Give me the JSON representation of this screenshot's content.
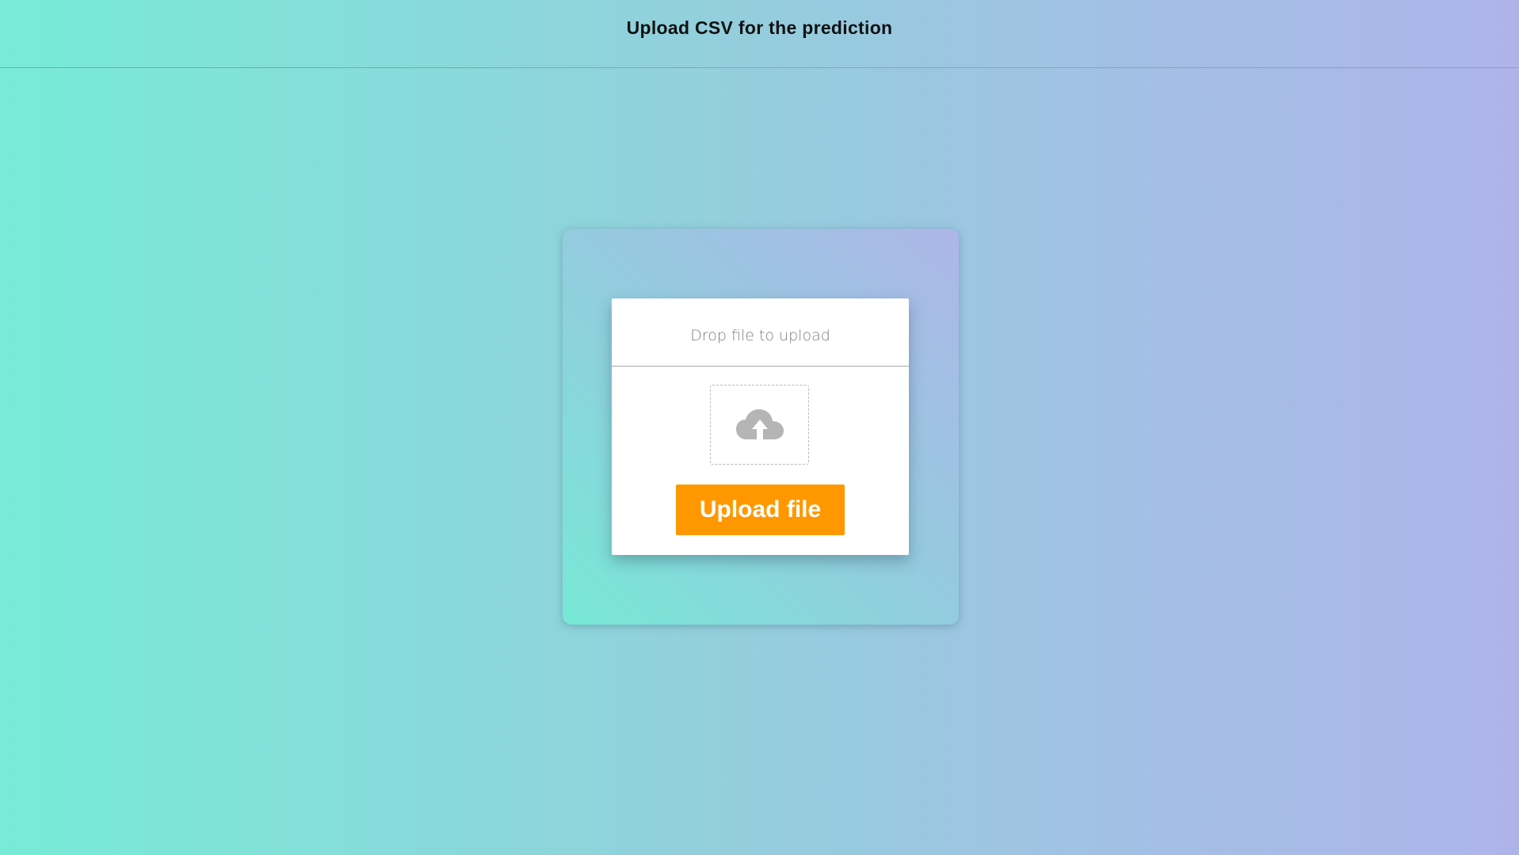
{
  "header": {
    "title": "Upload CSV for the prediction"
  },
  "upload_card": {
    "drop_title": "Drop file to upload",
    "drop_zone_icon": "cloud-upload-icon",
    "button_label": "Upload file"
  },
  "colors": {
    "accent": "#ff9800",
    "gradient_start": "#77ebd7",
    "gradient_end": "#aeb4ea",
    "icon_gray": "#b5b5b5"
  }
}
